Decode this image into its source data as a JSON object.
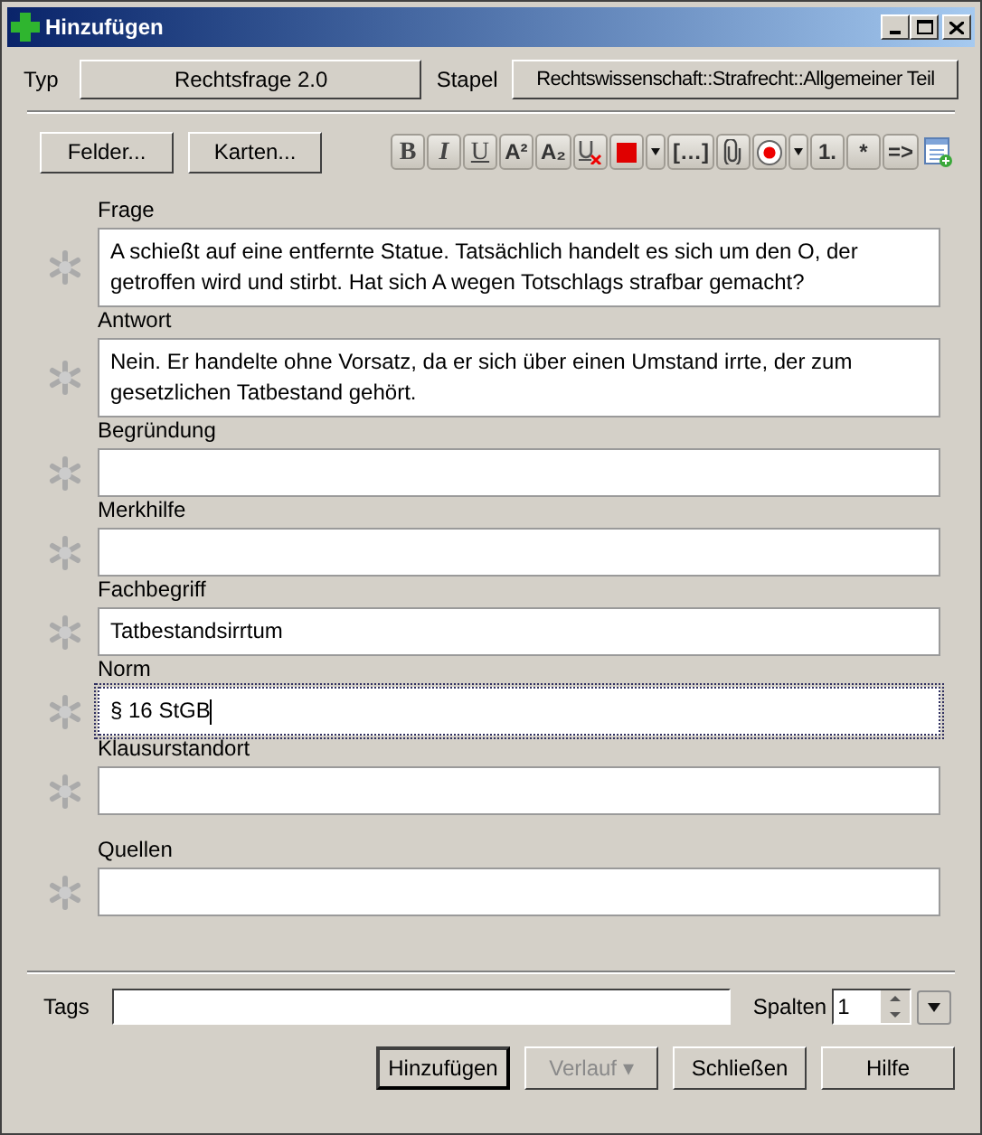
{
  "window": {
    "title": "Hinzufügen"
  },
  "type_row": {
    "type_label": "Typ",
    "type_value": "Rechtsfrage 2.0",
    "deck_label": "Stapel",
    "deck_value": "Rechtswissenschaft::Strafrecht::Allgemeiner Teil"
  },
  "left_buttons": [
    "Felder...",
    "Karten..."
  ],
  "toolbar": [
    {
      "kind": "bold",
      "label": "B"
    },
    {
      "kind": "italic",
      "label": "I"
    },
    {
      "kind": "underline",
      "label": "U"
    },
    {
      "kind": "text",
      "label": "A²"
    },
    {
      "kind": "text",
      "label": "A₂"
    },
    {
      "kind": "clear"
    },
    {
      "kind": "color",
      "color": "#e00000"
    },
    {
      "kind": "arrow"
    },
    {
      "kind": "text",
      "label": "[…]"
    },
    {
      "kind": "clip"
    },
    {
      "kind": "record"
    },
    {
      "kind": "arrow"
    },
    {
      "kind": "text",
      "label": "1."
    },
    {
      "kind": "text",
      "label": "*"
    },
    {
      "kind": "text",
      "label": "=>"
    },
    {
      "kind": "table"
    }
  ],
  "fields": [
    {
      "label": "Frage",
      "value": "A schießt auf eine entfernte Statue. Tatsächlich handelt es sich um den O, der getroffen wird und stirbt. Hat sich A wegen Totschlags strafbar gemacht?",
      "focused": false
    },
    {
      "label": "Antwort",
      "value": "Nein. Er handelte ohne Vorsatz, da er sich über einen Umstand irrte, der zum gesetzlichen Tatbestand gehört.",
      "focused": false
    },
    {
      "label": "Begründung",
      "focused": false
    },
    {
      "label": "Merkhilfe",
      "focused": false
    },
    {
      "label": "Fachbegriff",
      "value": "Tatbestandsirrtum",
      "focused": false
    },
    {
      "label": "Norm",
      "value": "§ 16 StGB",
      "focused": true
    },
    {
      "label": "Klausurstandort",
      "focused": false
    },
    {
      "label": "Quellen",
      "focused": false
    }
  ],
  "tags": {
    "label": "Tags"
  },
  "columns": {
    "label": "Spalten",
    "value": "1"
  },
  "buttons": [
    {
      "label": "Hinzufügen",
      "default": true,
      "disabled": false
    },
    {
      "label": "Verlauf ▾",
      "default": false,
      "disabled": true
    },
    {
      "label": "Schließen",
      "default": false,
      "disabled": false
    },
    {
      "label": "Hilfe",
      "default": false,
      "disabled": false
    }
  ]
}
